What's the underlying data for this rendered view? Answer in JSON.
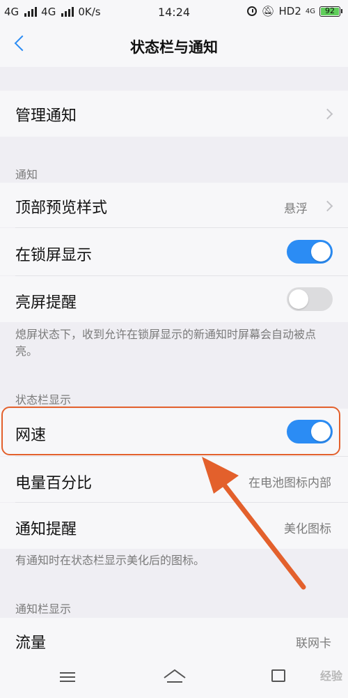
{
  "status_bar": {
    "network1": "4G",
    "network2": "4G",
    "speed": "0K/s",
    "time": "14:24",
    "hd": "HD2",
    "small_4g": "4G",
    "battery": "92"
  },
  "header": {
    "title": "状态栏与通知"
  },
  "rows": {
    "manage": {
      "label": "管理通知"
    },
    "preview": {
      "label": "顶部预览样式",
      "value": "悬浮"
    },
    "lockscreen": {
      "label": "在锁屏显示",
      "on": true
    },
    "wake": {
      "label": "亮屏提醒",
      "on": false
    },
    "netspeed": {
      "label": "网速",
      "on": true
    },
    "battery_pct": {
      "label": "电量百分比",
      "value": "在电池图标内部"
    },
    "notify_remind": {
      "label": "通知提醒",
      "value": "美化图标"
    },
    "traffic": {
      "label": "流量",
      "value": "联网卡"
    }
  },
  "sections": {
    "notify": "通知",
    "statusbar": "状态栏显示",
    "notifybar": "通知栏显示"
  },
  "descriptions": {
    "wake": "熄屏状态下，收到允许在锁屏显示的新通知时屏幕会自动被点亮。",
    "notify_remind": "有通知时在状态栏显示美化后的图标。"
  },
  "watermark": "经验",
  "colors": {
    "accent": "#2b8cf4",
    "annotation": "#e3602c"
  }
}
